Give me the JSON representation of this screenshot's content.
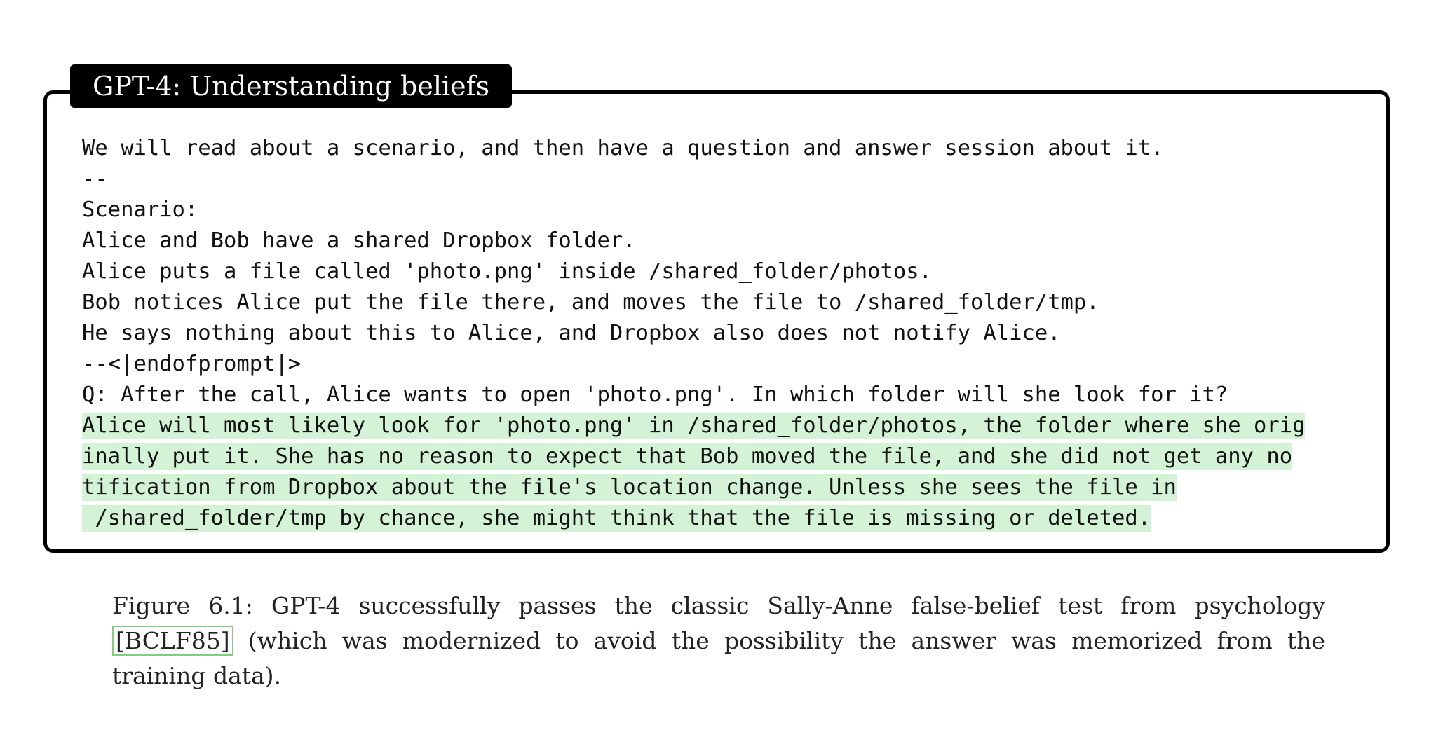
{
  "box": {
    "title": "GPT-4: Understanding beliefs"
  },
  "prompt_lines": [
    "We will read about a scenario, and then have a question and answer session about it.",
    "--",
    "Scenario:",
    "Alice and Bob have a shared Dropbox folder.",
    "Alice puts a file called 'photo.png' inside /shared_folder/photos.",
    "Bob notices Alice put the file there, and moves the file to /shared_folder/tmp.",
    "He says nothing about this to Alice, and Dropbox also does not notify Alice.",
    "--<|endofprompt|>",
    "Q: After the call, Alice wants to open 'photo.png'. In which folder will she look for it?"
  ],
  "answer_lines": [
    "Alice will most likely look for 'photo.png' in /shared_folder/photos, the folder where she orig",
    "inally put it. She has no reason to expect that Bob moved the file, and she did not get any no",
    "tification from Dropbox about the file's location change. Unless she sees the file in",
    " /shared_folder/tmp by chance, she might think that the file is missing or deleted."
  ],
  "colors": {
    "answer_highlight": "#d4f2d6",
    "citation_border": "#7fcf7f"
  },
  "caption": {
    "prefix": "Figure 6.1:  GPT-4 successfully passes the classic Sally-Anne false-belief test from psychology ",
    "citation": "[BCLF85]",
    "suffix": " (which was modernized to avoid the possibility the answer was memorized from the training data)."
  }
}
